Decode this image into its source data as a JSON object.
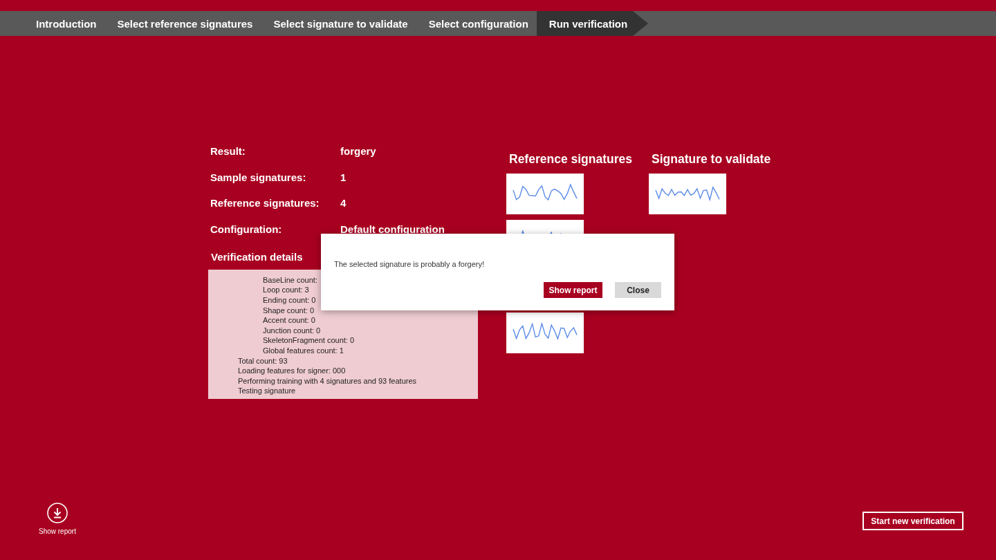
{
  "steps": [
    {
      "label": "Introduction",
      "selected": false
    },
    {
      "label": "Select reference signatures",
      "selected": false
    },
    {
      "label": "Select signature to validate",
      "selected": false
    },
    {
      "label": "Select configuration",
      "selected": false
    },
    {
      "label": "Run verification",
      "selected": true
    }
  ],
  "summary": [
    {
      "label": "Result:",
      "value": "forgery"
    },
    {
      "label": "Sample signatures:",
      "value": "1"
    },
    {
      "label": "Reference signatures:",
      "value": "4"
    },
    {
      "label": "Configuration:",
      "value": "Default configuration"
    }
  ],
  "details": {
    "title": "Verification details",
    "log": [
      {
        "children": [
          {
            "text": "BaseLine count:"
          },
          {
            "text": "Loop count: 3"
          },
          {
            "text": "Ending count: 0"
          },
          {
            "text": "Shape count: 0"
          },
          {
            "text": "Accent count: 0"
          },
          {
            "text": "Junction count: 0"
          },
          {
            "text": "SkeletonFragment count: 0"
          },
          {
            "text": "Global features count: 1"
          }
        ]
      },
      {
        "text": "Total count: 93"
      },
      {
        "text": "Loading features for signer: 000"
      },
      {
        "text": "Performing training with 4 signatures and 93 features"
      },
      {
        "text": "Testing signature"
      }
    ]
  },
  "reference_signatures": {
    "title": "Reference signatures",
    "items": [
      {
        "kind": "picture"
      },
      {
        "kind": "picture"
      },
      {
        "kind": "gap"
      },
      {
        "kind": "picture"
      }
    ]
  },
  "signature_to_validate": {
    "title": "Signature to validate",
    "items": [
      {
        "kind": "picture"
      }
    ]
  },
  "dialog": {
    "message": "The selected signature is probably a forgery!",
    "buttons": [
      {
        "label": "Show report",
        "kind": "primary"
      },
      {
        "label": "Close",
        "kind": "secondary"
      }
    ]
  },
  "app_bar": {
    "show_report": "Show report",
    "start_new": "Start new verification"
  }
}
